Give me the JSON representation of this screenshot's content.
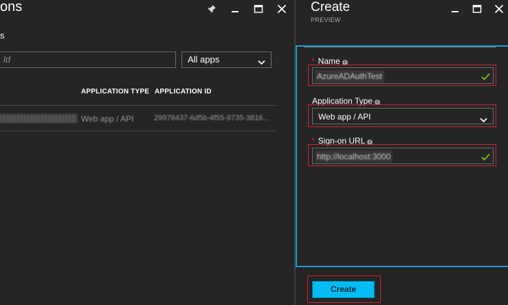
{
  "left_blade": {
    "title_fragment": "ons",
    "tab_fragment": "s",
    "search_placeholder_fragment": "ld",
    "filter": {
      "selected": "All apps"
    },
    "columns": [
      "APPLICATION TYPE",
      "APPLICATION ID"
    ],
    "rows": [
      {
        "type": "Web app / API",
        "id": "29978437-6d5b-4f55-9735-3816..."
      }
    ]
  },
  "create_blade": {
    "title": "Create",
    "subtitle": "PREVIEW",
    "fields": {
      "name": {
        "required_mark": "*",
        "label": "Name",
        "info": "i",
        "value": "AzureADAuthTest"
      },
      "app_type": {
        "label": "Application Type",
        "info": "i",
        "selected": "Web app / API"
      },
      "signon_url": {
        "required_mark": "*",
        "label": "Sign-on URL",
        "info": "i",
        "value": "http://localhost:3000"
      }
    },
    "create_label": "Create"
  },
  "colors": {
    "accent_blue": "#1a9ad6",
    "create_button": "#00bcf2",
    "highlight_red": "#d0242a",
    "valid_check": "#7fba00"
  },
  "icons": [
    "pin-icon",
    "minimize-icon",
    "maximize-icon",
    "close-icon",
    "chevron-down-icon",
    "checkmark-icon",
    "info-icon"
  ]
}
